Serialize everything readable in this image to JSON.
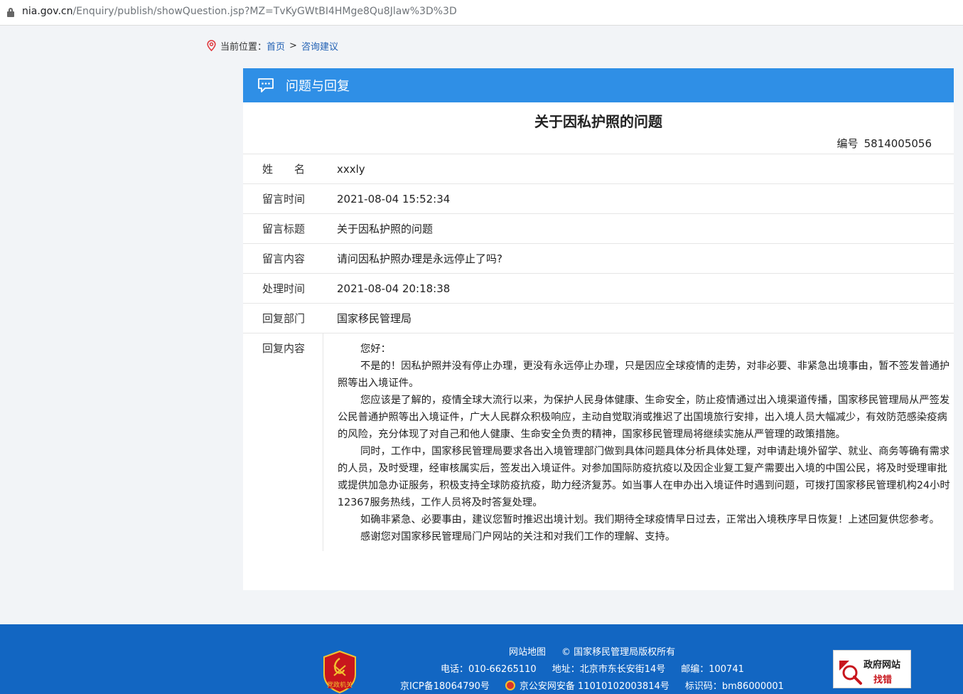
{
  "browser": {
    "url_host": "nia.gov.cn",
    "url_path": "/Enquiry/publish/showQuestion.jsp?MZ=TvKyGWtBI4HMge8Qu8Jlaw%3D%3D"
  },
  "breadcrumb": {
    "label": "当前位置：",
    "home": "首页",
    "separator": ">",
    "current": "咨询建议"
  },
  "panel": {
    "header_title": "问题与回复",
    "question_title": "关于因私护照的问题",
    "number_label": "编号",
    "number_value": "5814005056"
  },
  "rows": {
    "name_label": "姓　　名",
    "name_value": "xxxly",
    "msg_time_label": "留言时间",
    "msg_time_value": "2021-08-04 15:52:34",
    "msg_title_label": "留言标题",
    "msg_title_value": "关于因私护照的问题",
    "msg_content_label": "留言内容",
    "msg_content_value": "请问因私护照办理是永远停止了吗?",
    "handle_time_label": "处理时间",
    "handle_time_value": "2021-08-04 20:18:38",
    "reply_dept_label": "回复部门",
    "reply_dept_value": "国家移民管理局",
    "reply_content_label": "回复内容",
    "reply_paragraphs": [
      "您好：",
      "不是的！因私护照并没有停止办理，更没有永远停止办理，只是因应全球疫情的走势，对非必要、非紧急出境事由，暂不签发普通护照等出入境证件。",
      "您应该是了解的，疫情全球大流行以来，为保护人民身体健康、生命安全，防止疫情通过出入境渠道传播，国家移民管理局从严签发公民普通护照等出入境证件，广大人民群众积极响应，主动自觉取消或推迟了出国境旅行安排，出入境人员大幅减少，有效防范感染疫病的风险，充分体现了对自己和他人健康、生命安全负责的精神，国家移民管理局将继续实施从严管理的政策措施。",
      "同时，工作中，国家移民管理局要求各出入境管理部门做到具体问题具体分析具体处理，对申请赴境外留学、就业、商务等确有需求的人员，及时受理，经审核属实后，签发出入境证件。对参加国际防疫抗疫以及因企业复工复产需要出入境的中国公民，将及时受理审批或提供加急办证服务，积极支持全球防疫抗疫，助力经济复苏。如当事人在申办出入境证件时遇到问题，可拨打国家移民管理机构24小时12367服务热线，工作人员将及时答复处理。",
      "如确非紧急、必要事由，建议您暂时推迟出境计划。我们期待全球疫情早日过去，正常出入境秩序早日恢复！上述回复供您参考。",
      "感谢您对国家移民管理局门户网站的关注和对我们工作的理解、支持。"
    ]
  },
  "footer": {
    "sitemap": "网站地图",
    "copyright": "© 国家移民管理局版权所有",
    "phone": "电话：010-66265110",
    "address": "地址：北京市东长安街14号",
    "postcode": "邮编：100741",
    "icp": "京ICP备18064790号",
    "police_record": "京公安网安备  11010102003814号",
    "site_id": "标识码：bm86000001",
    "emblem_text": "党政机关",
    "find_error_line1": "政府网站",
    "find_error_line2": "找错"
  }
}
